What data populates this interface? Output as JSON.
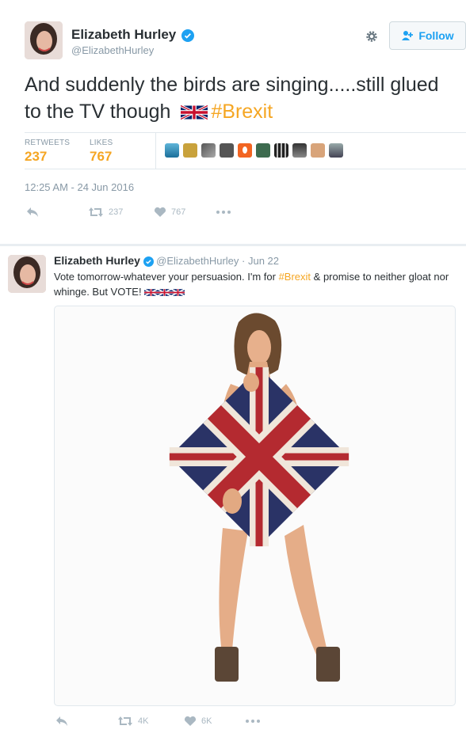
{
  "main_tweet": {
    "author_name": "Elizabeth Hurley",
    "author_handle": "@ElizabethHurley",
    "follow_label": "Follow",
    "text_part1": "And suddenly the birds are singing.....still glued to the TV though",
    "hashtag": "#Brexit",
    "retweets_label": "RETWEETS",
    "retweets_count": "237",
    "likes_label": "LIKES",
    "likes_count": "767",
    "timestamp": "12:25 AM - 24 Jun 2016",
    "action_retweet_count": "237",
    "action_like_count": "767",
    "liker_avatar_icons": [
      "avatar-1",
      "avatar-2",
      "avatar-3",
      "avatar-4",
      "avatar-5",
      "avatar-6",
      "avatar-7",
      "avatar-8",
      "avatar-9",
      "avatar-10"
    ]
  },
  "quoted_tweet": {
    "author_name": "Elizabeth Hurley",
    "author_handle": "@ElizabethHurley",
    "date": "· Jun 22",
    "text_part1": "Vote tomorrow-whatever your persuasion. I'm for",
    "hashtag": "#Brexit",
    "text_part2": "& promise to neither gloat nor whinge. But VOTE!",
    "retweet_count": "4K",
    "like_count": "6K"
  },
  "colors": {
    "accent": "#f5a623",
    "link_blue": "#1da1f2",
    "muted": "#8899a6",
    "divider": "#e1e8ed"
  }
}
